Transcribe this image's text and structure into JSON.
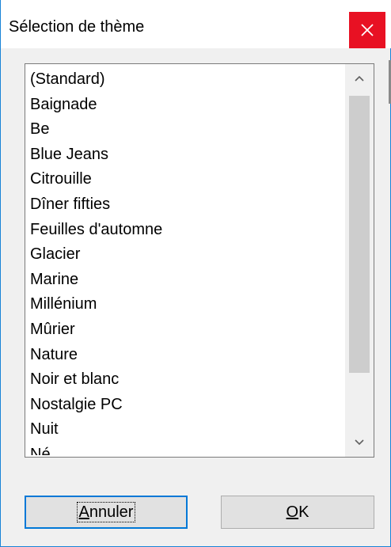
{
  "dialog": {
    "title": "Sélection de thème"
  },
  "theme_list": {
    "items": [
      "(Standard)",
      "Baignade",
      "Be",
      "Blue Jeans",
      "Citrouille",
      "Dîner fifties",
      "Feuilles d'automne",
      "Glacier",
      "Marine",
      "Millénium",
      "Mûrier",
      "Nature",
      "Noir et blanc",
      "Nostalgie PC",
      "Nuit",
      "Né..."
    ]
  },
  "buttons": {
    "cancel_label": "Annuler",
    "ok_label": "OK"
  },
  "icons": {
    "close": "close-icon",
    "scroll_up": "chevron-up-icon",
    "scroll_down": "chevron-down-icon"
  },
  "colors": {
    "close_background": "#e81123",
    "focus_border": "#0078d7",
    "window_border": "#1883d7"
  }
}
